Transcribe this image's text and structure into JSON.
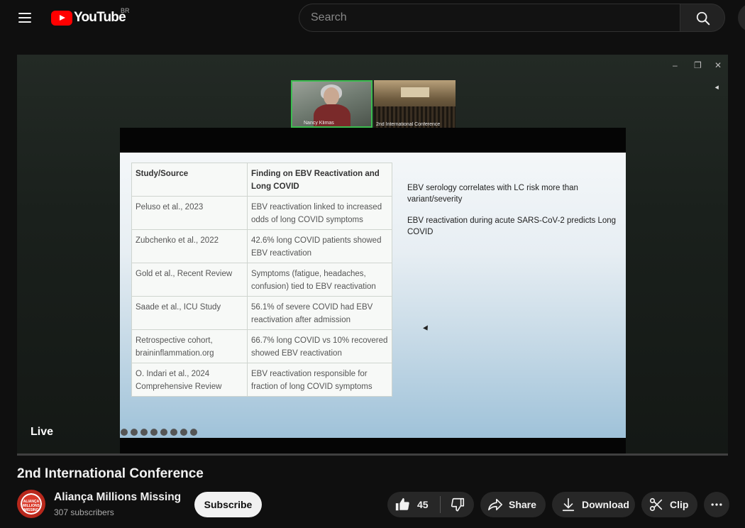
{
  "header": {
    "logo_text": "YouTube",
    "country_code": "BR",
    "search_placeholder": "Search"
  },
  "player": {
    "live_label": "Live",
    "participants": [
      {
        "name": "Nancy Klimas"
      },
      {
        "name": "2nd International Conference"
      }
    ],
    "slide": {
      "table_headers": [
        "Study/Source",
        "Finding on EBV Reactivation and Long COVID"
      ],
      "table_rows": [
        [
          "Peluso et al., 2023",
          "EBV reactivation linked to increased odds of long COVID symptoms"
        ],
        [
          "Zubchenko et al., 2022",
          "42.6% long COVID patients showed EBV reactivation"
        ],
        [
          "Gold et al., Recent Review",
          "Symptoms (fatigue, headaches, confusion) tied to EBV reactivation"
        ],
        [
          "Saade et al., ICU Study",
          "56.1% of severe COVID had EBV reactivation after admission"
        ],
        [
          "Retrospective cohort, braininflammation.org",
          "66.7% long COVID vs 10% recovered showed EBV reactivation"
        ],
        [
          "O. Indari et al., 2024 Comprehensive Review",
          "EBV reactivation responsible for fraction of long COVID symptoms"
        ]
      ],
      "notes": [
        "EBV serology correlates with LC risk more than variant/severity",
        "EBV reactivation during acute SARS-CoV-2 predicts Long COVID"
      ]
    }
  },
  "video": {
    "title": "2nd International Conference"
  },
  "channel": {
    "name": "Aliança Millions Missing",
    "subscribers": "307 subscribers",
    "avatar_text": "ALIANÇA MILLIONS MISSING"
  },
  "actions": {
    "subscribe_label": "Subscribe",
    "like_count": "45",
    "share_label": "Share",
    "download_label": "Download",
    "clip_label": "Clip"
  }
}
